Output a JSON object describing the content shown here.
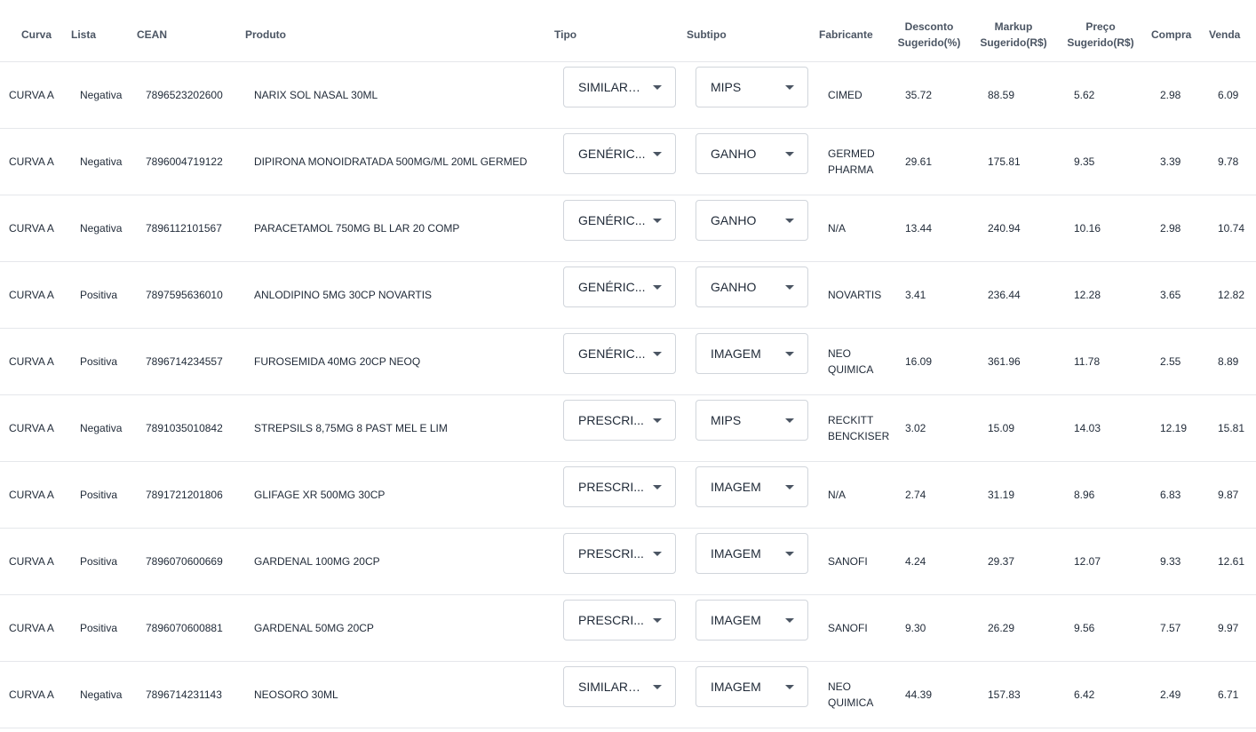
{
  "columns": {
    "curva": "Curva",
    "lista": "Lista",
    "cean": "CEAN",
    "produto": "Produto",
    "tipo": "Tipo",
    "subtipo": "Subtipo",
    "fabricante": "Fabricante",
    "desconto_l1": "Desconto",
    "desconto_l2": "Sugerido(%)",
    "markup_l1": "Markup",
    "markup_l2": "Sugerido(R$)",
    "preco_l1": "Preço",
    "preco_l2": "Sugerido(R$)",
    "compra": "Compra",
    "venda": "Venda"
  },
  "rows": [
    {
      "curva": "CURVA A",
      "lista": "Negativa",
      "cean": "7896523202600",
      "produto": "NARIX SOL NASAL 30ML",
      "tipo": "SIMILARE...",
      "subtipo": "MIPS",
      "fabricante": "CIMED",
      "desconto": "35.72",
      "markup": "88.59",
      "preco": "5.62",
      "compra": "2.98",
      "venda": "6.09"
    },
    {
      "curva": "CURVA A",
      "lista": "Negativa",
      "cean": "7896004719122",
      "produto": "DIPIRONA MONOIDRATADA 500MG/ML 20ML GERMED",
      "tipo": "GENÉRIC...",
      "subtipo": "GANHO",
      "fabricante": "GERMED PHARMA",
      "desconto": "29.61",
      "markup": "175.81",
      "preco": "9.35",
      "compra": "3.39",
      "venda": "9.78"
    },
    {
      "curva": "CURVA A",
      "lista": "Negativa",
      "cean": "7896112101567",
      "produto": "PARACETAMOL 750MG BL LAR 20 COMP",
      "tipo": "GENÉRIC...",
      "subtipo": "GANHO",
      "fabricante": "N/A",
      "desconto": "13.44",
      "markup": "240.94",
      "preco": "10.16",
      "compra": "2.98",
      "venda": "10.74"
    },
    {
      "curva": "CURVA A",
      "lista": "Positiva",
      "cean": "7897595636010",
      "produto": "ANLODIPINO 5MG 30CP NOVARTIS",
      "tipo": "GENÉRIC...",
      "subtipo": "GANHO",
      "fabricante": "NOVARTIS",
      "desconto": "3.41",
      "markup": "236.44",
      "preco": "12.28",
      "compra": "3.65",
      "venda": "12.82"
    },
    {
      "curva": "CURVA A",
      "lista": "Positiva",
      "cean": "7896714234557",
      "produto": "FUROSEMIDA 40MG 20CP NEOQ",
      "tipo": "GENÉRIC...",
      "subtipo": "IMAGEM",
      "fabricante": "NEO QUIMICA",
      "desconto": "16.09",
      "markup": "361.96",
      "preco": "11.78",
      "compra": "2.55",
      "venda": "8.89"
    },
    {
      "curva": "CURVA A",
      "lista": "Negativa",
      "cean": "7891035010842",
      "produto": "STREPSILS 8,75MG 8 PAST MEL E LIM",
      "tipo": "PRESCRI...",
      "subtipo": "MIPS",
      "fabricante": "RECKITT BENCKISER",
      "desconto": "3.02",
      "markup": "15.09",
      "preco": "14.03",
      "compra": "12.19",
      "venda": "15.81"
    },
    {
      "curva": "CURVA A",
      "lista": "Positiva",
      "cean": "7891721201806",
      "produto": "GLIFAGE XR 500MG 30CP",
      "tipo": "PRESCRI...",
      "subtipo": "IMAGEM",
      "fabricante": "N/A",
      "desconto": "2.74",
      "markup": "31.19",
      "preco": "8.96",
      "compra": "6.83",
      "venda": "9.87"
    },
    {
      "curva": "CURVA A",
      "lista": "Positiva",
      "cean": "7896070600669",
      "produto": "GARDENAL 100MG 20CP",
      "tipo": "PRESCRI...",
      "subtipo": "IMAGEM",
      "fabricante": "SANOFI",
      "desconto": "4.24",
      "markup": "29.37",
      "preco": "12.07",
      "compra": "9.33",
      "venda": "12.61"
    },
    {
      "curva": "CURVA A",
      "lista": "Positiva",
      "cean": "7896070600881",
      "produto": "GARDENAL 50MG 20CP",
      "tipo": "PRESCRI...",
      "subtipo": "IMAGEM",
      "fabricante": "SANOFI",
      "desconto": "9.30",
      "markup": "26.29",
      "preco": "9.56",
      "compra": "7.57",
      "venda": "9.97"
    },
    {
      "curva": "CURVA A",
      "lista": "Negativa",
      "cean": "7896714231143",
      "produto": "NEOSORO 30ML",
      "tipo": "SIMILARE...",
      "subtipo": "IMAGEM",
      "fabricante": "NEO QUIMICA",
      "desconto": "44.39",
      "markup": "157.83",
      "preco": "6.42",
      "compra": "2.49",
      "venda": "6.71"
    }
  ]
}
